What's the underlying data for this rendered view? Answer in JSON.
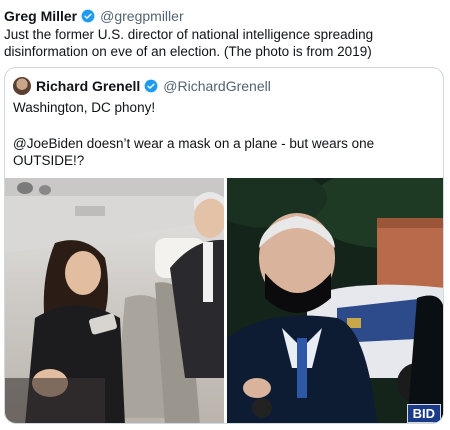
{
  "tweet": {
    "author_name": "Greg Miller",
    "author_handle": "@gregpmiller",
    "text": "Just the former U.S. director of national intelligence spreading disinformation on eve of an election. (The photo is from 2019)"
  },
  "quoted_tweet": {
    "author_name": "Richard Grenell",
    "author_handle": "@RichardGrenell",
    "line1": "Washington, DC phony!",
    "line2": "@JoeBiden doesn’t wear a mask on a plane - but wears one OUTSIDE!?",
    "media": {
      "left_photo": "airplane-cabin-photo",
      "right_photo": "outdoor-masked-photo",
      "right_overlay_text": "BID"
    }
  },
  "colors": {
    "verified_blue": "#1d9bf0",
    "secondary_text": "#536471",
    "border": "#cfd9de"
  }
}
